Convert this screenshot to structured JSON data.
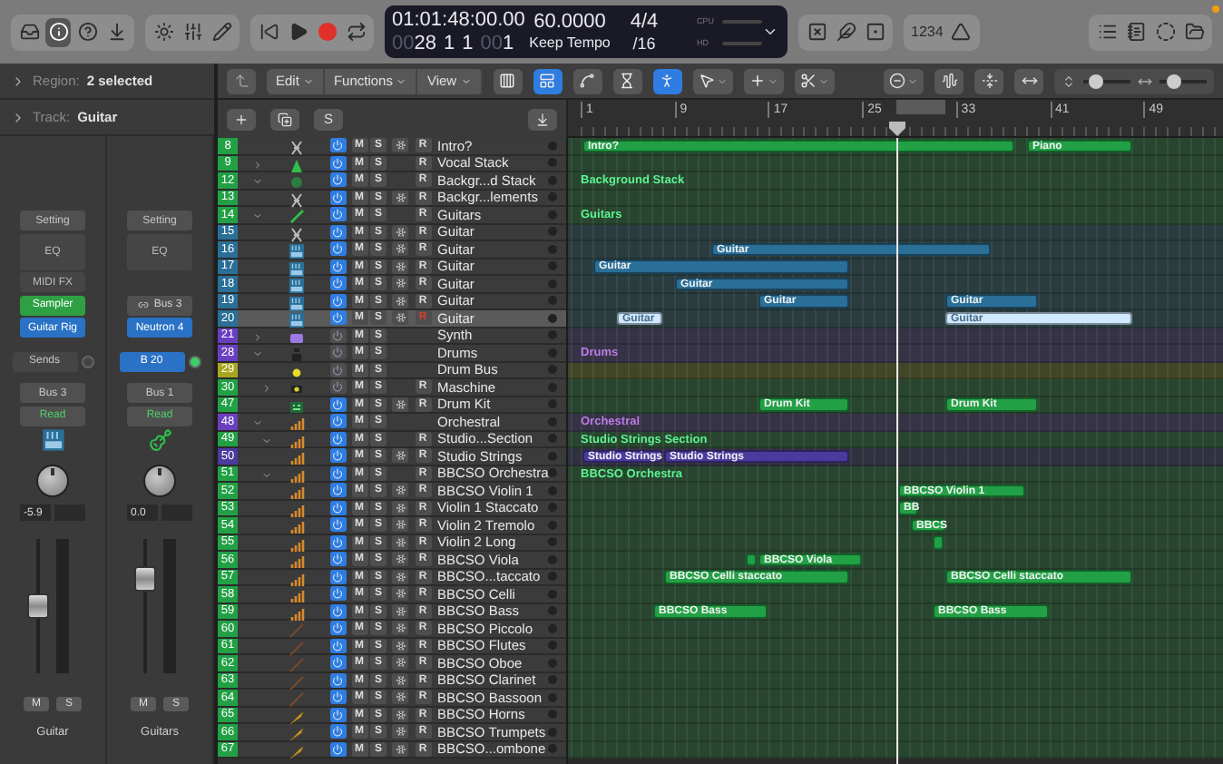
{
  "toolbar": {
    "left_groups": [
      [
        {
          "kind": "library",
          "selected": false
        },
        {
          "kind": "info",
          "selected": true
        },
        {
          "kind": "help",
          "selected": false
        },
        {
          "kind": "download",
          "selected": false
        }
      ],
      [
        {
          "kind": "brightness",
          "selected": false
        },
        {
          "kind": "mixer",
          "selected": false
        },
        {
          "kind": "pencil",
          "selected": false
        }
      ],
      [
        {
          "kind": "to_start",
          "selected": false
        },
        {
          "kind": "play",
          "selected": false
        },
        {
          "kind": "record",
          "selected": false
        },
        {
          "kind": "cycle",
          "selected": false
        }
      ]
    ],
    "lcd": {
      "time": "01:01:48:00.00",
      "tempo": "60.0000",
      "signature": "4/4",
      "bar_dim": "00",
      "bar": "28",
      "beat": "1",
      "division": "1",
      "tick_dim": "00",
      "tick": "1",
      "tempo_mode": "Keep Tempo",
      "note_value": "/16",
      "cpu_label": "CPU",
      "hd_label": "HD"
    },
    "right_groups": [
      [
        {
          "kind": "tuner",
          "selected": false
        },
        {
          "kind": "fade",
          "selected": false
        },
        {
          "kind": "score",
          "selected": false
        }
      ],
      [
        {
          "kind": "count_in",
          "label": "1234",
          "selected": false
        },
        {
          "kind": "metronome",
          "selected": false
        }
      ],
      [
        {
          "kind": "list",
          "selected": false
        },
        {
          "kind": "notes",
          "selected": false
        },
        {
          "kind": "loops",
          "selected": false
        },
        {
          "kind": "browser",
          "selected": false
        }
      ]
    ]
  },
  "inspector": {
    "region_label": "Region:",
    "region_value": "2 selected",
    "track_label": "Track:",
    "track_value": "Guitar",
    "strips": [
      {
        "kind": "keyboard",
        "setting": "Setting",
        "eq": "EQ",
        "slots": [
          {
            "kind": "midi",
            "label": "MIDI FX"
          },
          {
            "kind": "instrument",
            "label": "Sampler"
          },
          {
            "kind": "audio",
            "label": "Guitar Rig"
          }
        ],
        "send": {
          "kind": "placeholder",
          "label": "Sends"
        },
        "output": "Bus 3",
        "automation": "Read",
        "volume": "-5.9",
        "level": 0.49,
        "mute": "M",
        "solo": "S",
        "name": "Guitar"
      },
      {
        "kind": "guitar",
        "setting": "Setting",
        "eq": "EQ",
        "slots": [
          {
            "kind": "blank"
          },
          {
            "kind": "input",
            "label": "Bus 3"
          },
          {
            "kind": "audio",
            "label": "Neutron 4"
          }
        ],
        "send": {
          "kind": "bus",
          "label": "B 20"
        },
        "output": "Bus 1",
        "automation": "Read",
        "volume": "0.0",
        "level": 0.74,
        "mute": "M",
        "solo": "S",
        "name": "Guitars"
      }
    ]
  },
  "tracks_header": {
    "menus": [
      "Edit",
      "Functions",
      "View"
    ],
    "tools": [
      {
        "kind": "grid",
        "selected": false
      },
      {
        "kind": "panels",
        "selected": true
      },
      {
        "kind": "automation",
        "selected": false
      },
      {
        "kind": "flex",
        "selected": false
      },
      {
        "kind": "catch",
        "selected": true
      },
      {
        "kind": "pointer",
        "selected": false
      },
      {
        "kind": "plus",
        "selected": false
      },
      {
        "kind": "scissors",
        "selected": false
      }
    ],
    "solo_label": "S",
    "zoom_sliders": [
      {
        "level": 0.15
      },
      {
        "level": 0.2
      }
    ]
  },
  "ruler": {
    "bars": [
      "1",
      "9",
      "17",
      "25",
      "33",
      "41",
      "49"
    ]
  },
  "tracks": [
    {
      "number": "8",
      "name": "Intro?",
      "color": "#22a045",
      "kind": "figure",
      "power": true,
      "mute": "M",
      "solo": "S",
      "freeze": true,
      "record": "R",
      "armed": false,
      "selected": false,
      "regions": [
        {
          "label": "Intro?",
          "selected": false
        },
        {
          "label": "Piano",
          "selected": false
        }
      ]
    },
    {
      "number": "9",
      "name": "Vocal Stack",
      "color": "#22a045",
      "kind": "vocal",
      "expanded": false,
      "power": true,
      "mute": "M",
      "solo": "S",
      "freeze": false,
      "record": "R",
      "armed": false,
      "selected": false
    },
    {
      "number": "12",
      "name": "Backgr...d Stack",
      "color": "#22a045",
      "kind": "blob",
      "expanded": true,
      "power": true,
      "mute": "M",
      "solo": "S",
      "freeze": false,
      "record": "R",
      "armed": false,
      "selected": false,
      "lane_label": "Background Stack",
      "children": [
        {
          "number": "13",
          "name": "Backgr...lements",
          "color": "#22a045",
          "kind": "figure",
          "power": true,
          "mute": "M",
          "solo": "S",
          "freeze": true,
          "record": "R",
          "armed": false,
          "selected": false
        }
      ]
    },
    {
      "number": "14",
      "name": "Guitars",
      "color": "#22a045",
      "kind": "guitar",
      "expanded": true,
      "power": true,
      "mute": "M",
      "solo": "S",
      "freeze": false,
      "record": "R",
      "armed": false,
      "selected": false,
      "lane_label": "Guitars",
      "children": [
        {
          "number": "15",
          "name": "Guitar",
          "color": "#2a6f97",
          "kind": "figure",
          "power": true,
          "mute": "M",
          "solo": "S",
          "freeze": true,
          "record": "R",
          "armed": false,
          "selected": false
        },
        {
          "number": "16",
          "name": "Guitar",
          "color": "#2a6f97",
          "kind": "keyboard",
          "power": true,
          "mute": "M",
          "solo": "S",
          "freeze": true,
          "record": "R",
          "armed": false,
          "selected": false,
          "regions": [
            {
              "label": "Guitar",
              "selected": false
            }
          ]
        },
        {
          "number": "17",
          "name": "Guitar",
          "color": "#2a6f97",
          "kind": "keyboard",
          "power": true,
          "mute": "M",
          "solo": "S",
          "freeze": true,
          "record": "R",
          "armed": false,
          "selected": false,
          "regions": [
            {
              "label": "Guitar",
              "selected": false
            }
          ]
        },
        {
          "number": "18",
          "name": "Guitar",
          "color": "#2a6f97",
          "kind": "keyboard",
          "power": true,
          "mute": "M",
          "solo": "S",
          "freeze": true,
          "record": "R",
          "armed": false,
          "selected": false,
          "regions": [
            {
              "label": "Guitar",
              "selected": false
            }
          ]
        },
        {
          "number": "19",
          "name": "Guitar",
          "color": "#2a6f97",
          "kind": "keyboard",
          "power": true,
          "mute": "M",
          "solo": "S",
          "freeze": true,
          "record": "R",
          "armed": false,
          "selected": false,
          "regions": [
            {
              "label": "Guitar",
              "selected": false
            },
            {
              "label": "Guitar",
              "selected": false
            }
          ]
        },
        {
          "number": "20",
          "name": "Guitar",
          "color": "#2a6f97",
          "kind": "keyboard",
          "power": true,
          "mute": "M",
          "solo": "S",
          "freeze": true,
          "record": "R",
          "armed": true,
          "selected": true,
          "regions": [
            {
              "label": "Guitar",
              "selected": true
            },
            {
              "label": "Guitar",
              "selected": true
            }
          ]
        }
      ]
    },
    {
      "number": "21",
      "name": "Synth",
      "color": "#6a3fbf",
      "kind": "synth",
      "expanded": false,
      "power": false,
      "mute": "M",
      "solo": "S",
      "freeze": false,
      "selected": false
    },
    {
      "number": "28",
      "name": "Drums",
      "color": "#6a3fbf",
      "kind": "drums",
      "expanded": true,
      "power": false,
      "mute": "M",
      "solo": "S",
      "freeze": false,
      "selected": false,
      "lane_label": "Drums",
      "children": [
        {
          "number": "29",
          "name": "Drum Bus",
          "color": "#a8a51f",
          "kind": "dot",
          "power": false,
          "mute": "M",
          "solo": "S",
          "freeze": false,
          "selected": false
        },
        {
          "number": "30",
          "name": "Maschine",
          "color": "#22a045",
          "kind": "pad",
          "expanded": false,
          "power": false,
          "mute": "M",
          "solo": "S",
          "freeze": false,
          "record": "R",
          "armed": false,
          "selected": false
        },
        {
          "number": "47",
          "name": "Drum Kit",
          "color": "#22a045",
          "kind": "machine",
          "power": true,
          "mute": "M",
          "solo": "S",
          "freeze": true,
          "record": "R",
          "armed": false,
          "selected": false,
          "regions": [
            {
              "label": "Drum Kit",
              "selected": false
            },
            {
              "label": "Drum Kit",
              "selected": false
            }
          ]
        }
      ]
    },
    {
      "number": "48",
      "name": "Orchestral",
      "color": "#6a3fbf",
      "kind": "strings",
      "expanded": true,
      "power": true,
      "mute": "M",
      "solo": "S",
      "freeze": false,
      "selected": false,
      "lane_label": "Orchestral",
      "children": [
        {
          "number": "49",
          "name": "Studio...Section",
          "color": "#22a045",
          "kind": "strings",
          "expanded": true,
          "power": true,
          "mute": "M",
          "solo": "S",
          "freeze": false,
          "record": "R",
          "armed": false,
          "selected": false,
          "lane_label": "Studio Strings Section",
          "children": [
            {
              "number": "50",
              "name": "Studio Strings",
              "color": "#4b3a9e",
              "kind": "strings",
              "power": true,
              "mute": "M",
              "solo": "S",
              "freeze": true,
              "record": "R",
              "armed": false,
              "selected": false,
              "regions": [
                {
                  "label": "Studio Strings",
                  "selected": false
                },
                {
                  "label": "Studio Strings",
                  "selected": false
                }
              ]
            }
          ]
        },
        {
          "number": "51",
          "name": "BBCSO Orchestra",
          "color": "#22a045",
          "kind": "strings",
          "expanded": true,
          "power": true,
          "mute": "M",
          "solo": "S",
          "freeze": false,
          "record": "R",
          "armed": false,
          "selected": false,
          "lane_label": "BBCSO Orchestra",
          "children": [
            {
              "number": "52",
              "name": "BBCSO Violin 1",
              "color": "#22a045",
              "kind": "strings",
              "power": true,
              "mute": "M",
              "solo": "S",
              "freeze": true,
              "record": "R",
              "armed": false,
              "selected": false,
              "regions": [
                {
                  "label": "BBCSO Violin 1",
                  "selected": false
                }
              ]
            },
            {
              "number": "53",
              "name": "Violin 1 Staccato",
              "color": "#22a045",
              "kind": "strings",
              "power": true,
              "mute": "M",
              "solo": "S",
              "freeze": true,
              "record": "R",
              "armed": false,
              "selected": false,
              "regions": [
                {
                  "label": "BB",
                  "selected": false
                }
              ]
            },
            {
              "number": "54",
              "name": "Violin 2 Tremolo",
              "color": "#22a045",
              "kind": "strings",
              "power": true,
              "mute": "M",
              "solo": "S",
              "freeze": true,
              "record": "R",
              "armed": false,
              "selected": false,
              "regions": [
                {
                  "label": "BBCS",
                  "selected": false
                }
              ]
            },
            {
              "number": "55",
              "name": "Violin 2 Long",
              "color": "#22a045",
              "kind": "strings",
              "power": true,
              "mute": "M",
              "solo": "S",
              "freeze": true,
              "record": "R",
              "armed": false,
              "selected": false,
              "regions": [
                {
                  "selected": false
                }
              ]
            },
            {
              "number": "56",
              "name": "BBCSO Viola",
              "color": "#22a045",
              "kind": "strings",
              "power": true,
              "mute": "M",
              "solo": "S",
              "freeze": true,
              "record": "R",
              "armed": false,
              "selected": false,
              "regions": [
                {
                  "selected": false
                },
                {
                  "label": "BBCSO Viola",
                  "selected": false
                }
              ]
            },
            {
              "number": "57",
              "name": "BBCSO...taccato",
              "color": "#22a045",
              "kind": "strings",
              "power": true,
              "mute": "M",
              "solo": "S",
              "freeze": true,
              "record": "R",
              "armed": false,
              "selected": false,
              "regions": [
                {
                  "label": "BBCSO Celli staccato",
                  "selected": false
                },
                {
                  "label": "BBCSO Celli staccato",
                  "selected": false
                }
              ]
            },
            {
              "number": "58",
              "name": "BBCSO Celli",
              "color": "#22a045",
              "kind": "strings",
              "power": true,
              "mute": "M",
              "solo": "S",
              "freeze": true,
              "record": "R",
              "armed": false,
              "selected": false
            },
            {
              "number": "59",
              "name": "BBCSO Bass",
              "color": "#22a045",
              "kind": "strings",
              "power": true,
              "mute": "M",
              "solo": "S",
              "freeze": true,
              "record": "R",
              "armed": false,
              "selected": false,
              "regions": [
                {
                  "label": "BBCSO Bass",
                  "selected": false
                },
                {
                  "label": "BBCSO Bass",
                  "selected": false
                }
              ]
            },
            {
              "number": "60",
              "name": "BBCSO Piccolo",
              "color": "#22a045",
              "kind": "woodwind",
              "power": true,
              "mute": "M",
              "solo": "S",
              "freeze": true,
              "record": "R",
              "armed": false,
              "selected": false
            },
            {
              "number": "61",
              "name": "BBCSO Flutes",
              "color": "#22a045",
              "kind": "woodwind",
              "power": true,
              "mute": "M",
              "solo": "S",
              "freeze": true,
              "record": "R",
              "armed": false,
              "selected": false
            },
            {
              "number": "62",
              "name": "BBCSO Oboe",
              "color": "#22a045",
              "kind": "woodwind",
              "power": true,
              "mute": "M",
              "solo": "S",
              "freeze": true,
              "record": "R",
              "armed": false,
              "selected": false
            },
            {
              "number": "63",
              "name": "BBCSO Clarinet",
              "color": "#22a045",
              "kind": "woodwind",
              "power": true,
              "mute": "M",
              "solo": "S",
              "freeze": true,
              "record": "R",
              "armed": false,
              "selected": false
            },
            {
              "number": "64",
              "name": "BBCSO Bassoon",
              "color": "#22a045",
              "kind": "woodwind",
              "power": true,
              "mute": "M",
              "solo": "S",
              "freeze": true,
              "record": "R",
              "armed": false,
              "selected": false
            },
            {
              "number": "65",
              "name": "BBCSO Horns",
              "color": "#22a045",
              "kind": "horn",
              "power": true,
              "mute": "M",
              "solo": "S",
              "freeze": true,
              "record": "R",
              "armed": false,
              "selected": false
            },
            {
              "number": "66",
              "name": "BBCSO Trumpets",
              "color": "#22a045",
              "kind": "horn",
              "power": true,
              "mute": "M",
              "solo": "S",
              "freeze": true,
              "record": "R",
              "armed": false,
              "selected": false
            },
            {
              "number": "67",
              "name": "BBCSO...ombone",
              "color": "#22a045",
              "kind": "horn",
              "power": true,
              "mute": "M",
              "solo": "S",
              "freeze": true,
              "record": "R",
              "armed": false,
              "selected": false
            }
          ]
        }
      ]
    }
  ]
}
